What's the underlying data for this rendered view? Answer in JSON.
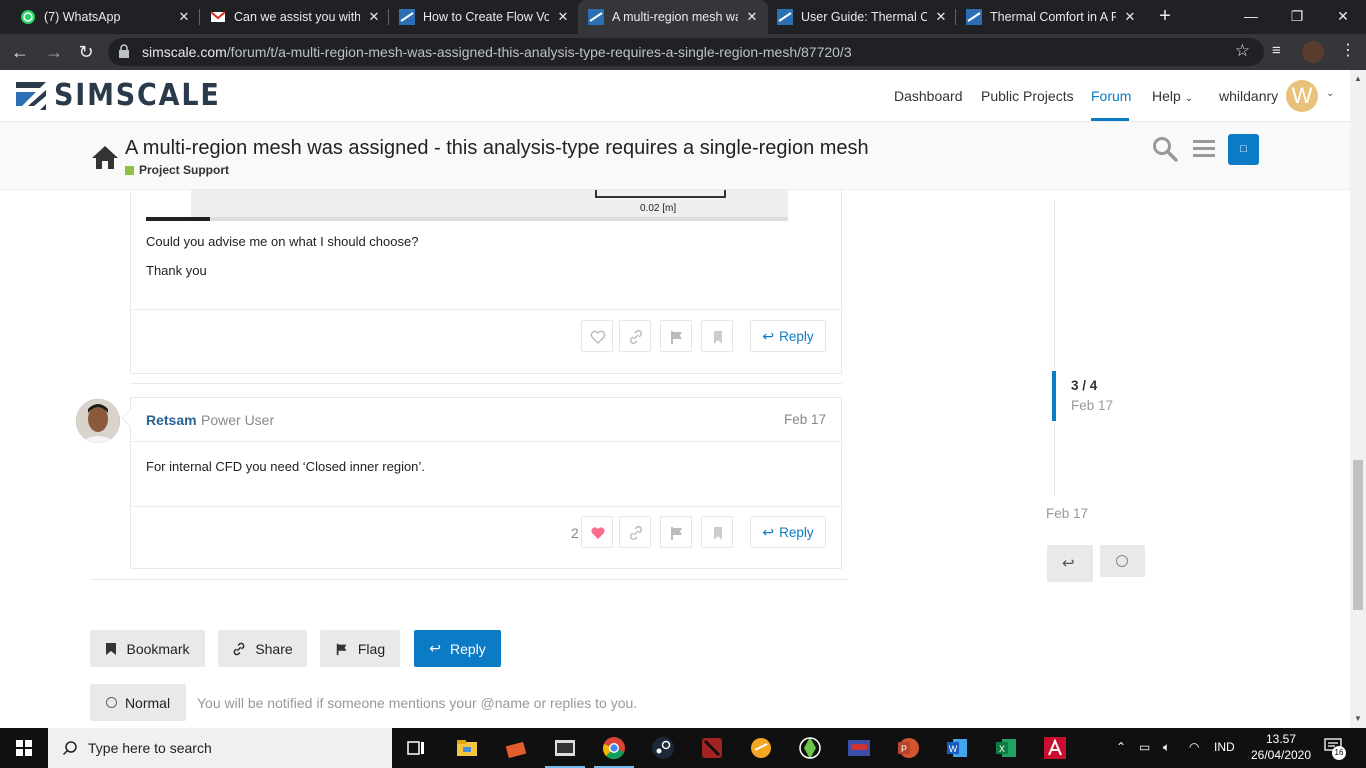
{
  "browser": {
    "tabs": [
      {
        "label": "(7) WhatsApp",
        "icon": "whatsapp-icon"
      },
      {
        "label": "Can we assist you with t",
        "icon": "gmail-icon"
      },
      {
        "label": "How to Create Flow Vol",
        "icon": "simscale-icon"
      },
      {
        "label": "A multi-region mesh wa",
        "icon": "simscale-icon"
      },
      {
        "label": "User Guide: Thermal Co",
        "icon": "simscale-icon"
      },
      {
        "label": "Thermal Comfort in A R",
        "icon": "simscale-icon"
      }
    ],
    "active_tab_index": 3,
    "url_domain": "simscale.com",
    "url_path": "/forum/t/a-multi-region-mesh-was-assigned-this-analysis-type-requires-a-single-region-mesh/87720/3"
  },
  "site": {
    "logo": "SIMSCALE",
    "nav": [
      "Dashboard",
      "Public Projects",
      "Forum",
      "Help"
    ],
    "active_nav": "Forum",
    "username": "whildanry",
    "avatar_letter": "W",
    "accent": "#0a7bc4"
  },
  "topic": {
    "title": "A multi-region mesh was assigned - this analysis-type requires a single-region mesh",
    "category": "Project Support",
    "category_color": "#8cc342"
  },
  "posts": [
    {
      "image_scale_label": "0.02 [m]",
      "paragraphs": [
        "Could you advise me on what I should choose?",
        "Thank you"
      ],
      "reply_label": "Reply"
    },
    {
      "username": "Retsam",
      "user_title": "Power User",
      "date": "Feb 17",
      "text": "For internal CFD you need ‘Closed inner region’.",
      "like_count": "2",
      "reply_label": "Reply"
    }
  ],
  "timeline": {
    "position": "3 / 4",
    "position_date": "Feb 17",
    "bottom_date": "Feb 17"
  },
  "footer": {
    "bookmark": "Bookmark",
    "share": "Share",
    "flag": "Flag",
    "reply": "Reply",
    "notification_level": "Normal",
    "notification_text": "You will be notified if someone mentions your @name or replies to you."
  },
  "taskbar": {
    "search_placeholder": "Type here to search",
    "language": "IND",
    "time": "13.57",
    "date": "26/04/2020",
    "notification_count": "16"
  }
}
